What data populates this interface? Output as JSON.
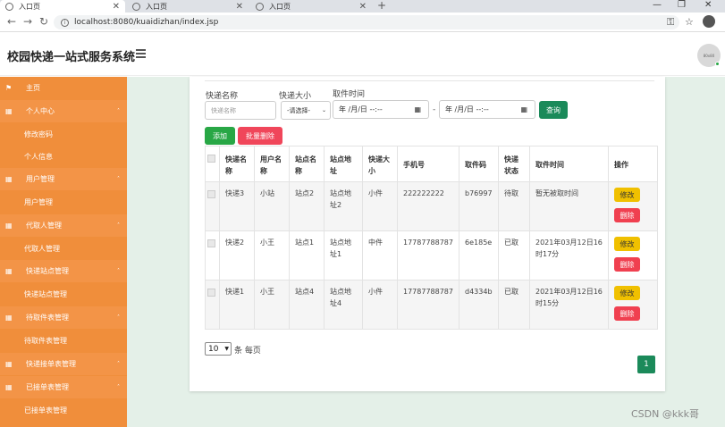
{
  "browser": {
    "tabs": [
      {
        "label": "入口页",
        "active": true
      },
      {
        "label": "入口页",
        "active": false
      },
      {
        "label": "入口页",
        "active": false
      }
    ],
    "url": "localhost:8080/kuaidizhan/index.jsp"
  },
  "header": {
    "title": "校园快递一站式服务系统",
    "avatar_text": "80x80"
  },
  "sidebar": {
    "home": "主页",
    "groups": [
      {
        "label": "个人中心",
        "children": [
          "修改密码",
          "个人信息"
        ]
      },
      {
        "label": "用户管理",
        "children": [
          "用户管理"
        ]
      },
      {
        "label": "代取人管理",
        "children": [
          "代取人管理"
        ]
      },
      {
        "label": "快递站点管理",
        "children": [
          "快递站点管理"
        ]
      },
      {
        "label": "待取件表管理",
        "children": [
          "待取件表管理"
        ]
      },
      {
        "label": "快递接单表管理",
        "children": []
      },
      {
        "label": "已接单表管理",
        "children": [
          "已接单表管理"
        ]
      }
    ]
  },
  "filters": {
    "name_label": "快递名称",
    "name_placeholder": "快递名称",
    "size_label": "快递大小",
    "size_value": "-请选择-",
    "time_label": "取件时间",
    "date_placeholder": "年 /月/日 --:--",
    "range_sep": "-",
    "query_label": "查询"
  },
  "actions": {
    "add_label": "添加",
    "batch_delete_label": "批量删除"
  },
  "table": {
    "headers": [
      "快递名称",
      "用户名称",
      "站点名称",
      "站点地址",
      "快递大小",
      "手机号",
      "取件码",
      "快递状态",
      "取件时间",
      "操作"
    ],
    "rows": [
      {
        "express_name": "快递3",
        "user_name": "小站",
        "site_name": "站点2",
        "site_address": "站点地址2",
        "size": "小件",
        "phone": "222222222",
        "pickup_code": "b76997",
        "status": "待取",
        "pickup_time": "暂无被取时间"
      },
      {
        "express_name": "快递2",
        "user_name": "小王",
        "site_name": "站点1",
        "site_address": "站点地址1",
        "size": "中件",
        "phone": "17787788787",
        "pickup_code": "6e185e",
        "status": "已取",
        "pickup_time": "2021年03月12日16时17分"
      },
      {
        "express_name": "快递1",
        "user_name": "小王",
        "site_name": "站点4",
        "site_address": "站点地址4",
        "size": "小件",
        "phone": "17787788787",
        "pickup_code": "d4334b",
        "status": "已取",
        "pickup_time": "2021年03月12日16时15分"
      }
    ],
    "edit_label": "修改",
    "delete_label": "删除"
  },
  "pagination": {
    "page_size": "10",
    "per_page_label": "条 每页",
    "current_page": "1"
  },
  "watermark": "CSDN @kkk哥"
}
